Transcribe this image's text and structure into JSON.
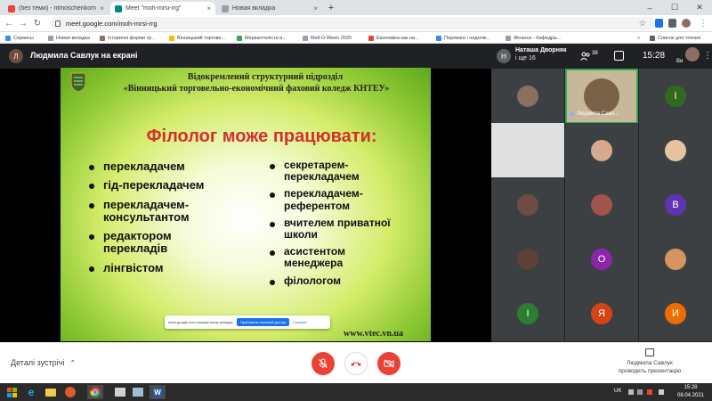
{
  "tabs": [
    {
      "title": "(без теми) - ntmoschenkom@g",
      "favicon_color": "#ea4335"
    },
    {
      "title": "Meet \"moh-mrsi-rrg\"",
      "favicon_color": "#00897b"
    },
    {
      "title": "Новая вкладка",
      "favicon_color": "#9aa0a6"
    }
  ],
  "new_tab_label": "+",
  "window_controls": {
    "minimize": "–",
    "maximize": "☐",
    "close": "✕"
  },
  "address": {
    "url": "meet.google.com/moh-mrsi-rrg"
  },
  "bookmarks": [
    {
      "label": "Сервисы",
      "color": "#4285f4"
    },
    {
      "label": "Новая вкладка",
      "color": "#9aa0a6"
    },
    {
      "label": "Історичні форми гр...",
      "color": "#8d6e63"
    },
    {
      "label": "Вінницький торгове...",
      "color": "#fbbc04"
    },
    {
      "label": "Меркантилісти и...",
      "color": "#34a853"
    },
    {
      "label": "Mell-O-Ween 2020",
      "color": "#9aa0a6"
    },
    {
      "label": "Економіка как на...",
      "color": "#ea4335"
    },
    {
      "label": "Переваги і недолік...",
      "color": "#4285f4"
    },
    {
      "label": "Фінанси - Кафедра...",
      "color": "#9aa0a6"
    }
  ],
  "bookmarks_more": "»",
  "reading_list": "Список для чтения",
  "meet": {
    "presenter_label": "Людмила Савлук на екрані",
    "presenter_initial": "Л",
    "pinned_name": "Наташа Дворняк",
    "pinned_more": "і ще 16",
    "pinned_initial": "Н",
    "participants_count": "38",
    "time": "15:28",
    "self_label": "Ви"
  },
  "slide": {
    "header1": "Відокремлений структурний підрозділ",
    "header2": "«Вінницький торговельно-економічний фаховий коледж КНТЕУ»",
    "title": "Філолог може працювати:",
    "left_items": [
      "перекладачем",
      "гід-перекладачем",
      "перекладачем-консультантом",
      "редактором перекладів",
      "лінгвістом"
    ],
    "right_items": [
      "секретарем-перекладачем",
      "перекладачем-референтом",
      "вчителем приватної школи",
      "асистентом менеджера",
      "філологом"
    ],
    "url": "www.vtec.vn.ua"
  },
  "share_banner": {
    "text": "meet.google.com показує вашу вкладку.",
    "stop_label": "Припинити спільний доступ",
    "hide_label": "Сховати"
  },
  "participants": [
    {
      "initial": "",
      "color": "#8d6e63",
      "label": ""
    },
    {
      "initial": "",
      "color": "#c8b89a",
      "label": "Людмила Савл..."
    },
    {
      "initial": "І",
      "color": "#33691e",
      "label": ""
    },
    {
      "initial": "",
      "color": "#e0e0e0",
      "label": ""
    },
    {
      "initial": "",
      "color": "#d7a98c",
      "label": ""
    },
    {
      "initial": "",
      "color": "#e8c3a0",
      "label": ""
    },
    {
      "initial": "",
      "color": "#6d4c41",
      "label": ""
    },
    {
      "initial": "",
      "color": "#a1544b",
      "label": ""
    },
    {
      "initial": "В",
      "color": "#5e35b1",
      "label": ""
    },
    {
      "initial": "",
      "color": "#5d4037",
      "label": ""
    },
    {
      "initial": "О",
      "color": "#8e24aa",
      "label": ""
    },
    {
      "initial": "",
      "color": "#d4955f",
      "label": ""
    },
    {
      "initial": "І",
      "color": "#2e7d32",
      "label": ""
    },
    {
      "initial": "Я",
      "color": "#d84315",
      "label": ""
    },
    {
      "initial": "И",
      "color": "#ef6c00",
      "label": ""
    }
  ],
  "bottom": {
    "details_label": "Деталі зустрічі",
    "mic_color": "#ea4335",
    "hangup_color": "#ea4335",
    "cam_color": "#ea4335",
    "presenting_name": "Людмила Савлук",
    "presenting_label": "проводить презентацію"
  },
  "taskbar": {
    "lang": "UK",
    "time": "15:28",
    "date": "08.04.2021"
  }
}
